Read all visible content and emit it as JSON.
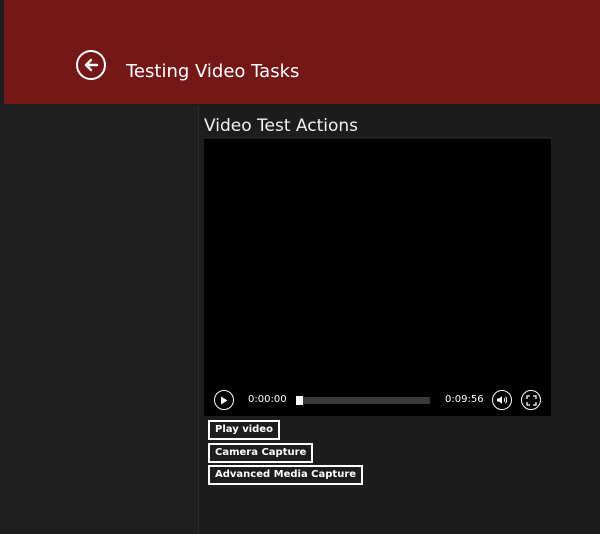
{
  "header": {
    "title": "Testing Video Tasks",
    "back_icon": "arrow-left-icon",
    "background": "#731717"
  },
  "main": {
    "section_title": "Video Test Actions",
    "player": {
      "elapsed": "0:00:00",
      "duration": "0:09:56",
      "progress": 0,
      "icons": [
        "play-icon",
        "volume-icon",
        "fullscreen-icon"
      ]
    },
    "buttons": {
      "play_video": "Play video",
      "camera_capture": "Camera Capture",
      "advanced_media_capture": "Advanced Media Capture"
    }
  }
}
